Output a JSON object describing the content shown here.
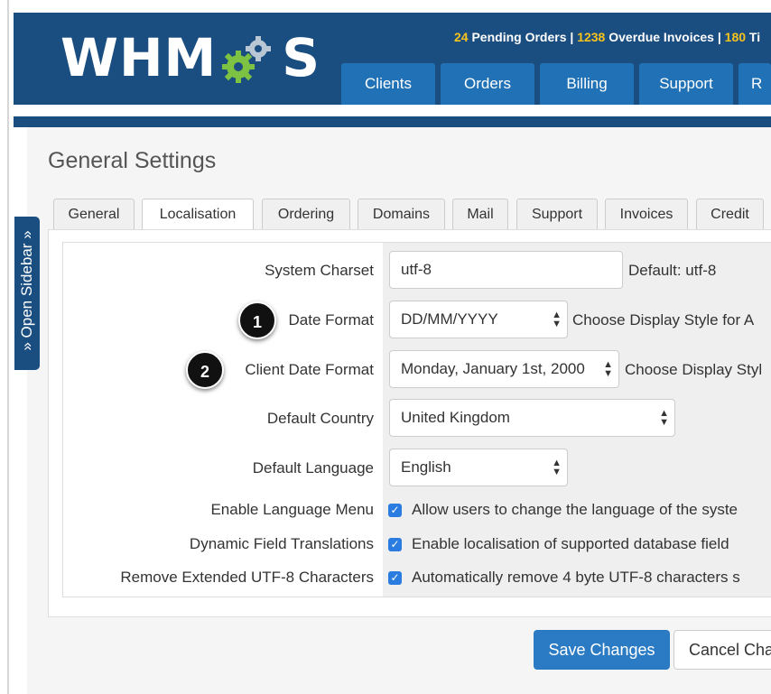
{
  "header": {
    "logo_left": "WHM",
    "logo_right": "S",
    "stats": [
      {
        "num": "24",
        "text": " Pending Orders | "
      },
      {
        "num": "1238",
        "text": " Overdue Invoices | "
      },
      {
        "num": "180",
        "text": " Ti"
      }
    ],
    "nav": [
      "Clients",
      "Orders",
      "Billing",
      "Support",
      "R"
    ]
  },
  "sidebar": {
    "toggle_label": "» Open Sidebar »"
  },
  "page": {
    "title": "General Settings"
  },
  "tabs": [
    {
      "label": "General",
      "active": false
    },
    {
      "label": "Localisation",
      "active": true
    },
    {
      "label": "Ordering",
      "active": false
    },
    {
      "label": "Domains",
      "active": false
    },
    {
      "label": "Mail",
      "active": false
    },
    {
      "label": "Support",
      "active": false
    },
    {
      "label": "Invoices",
      "active": false
    },
    {
      "label": "Credit",
      "active": false
    }
  ],
  "form": {
    "system_charset": {
      "label": "System Charset",
      "value": "utf-8",
      "hint": "Default: utf-8"
    },
    "date_format": {
      "label": "Date Format",
      "value": "DD/MM/YYYY",
      "hint": "Choose Display Style for A"
    },
    "client_date_format": {
      "label": "Client Date Format",
      "value": "Monday, January 1st, 2000",
      "hint": "Choose Display Styl"
    },
    "default_country": {
      "label": "Default Country",
      "value": "United Kingdom"
    },
    "default_language": {
      "label": "Default Language",
      "value": "English"
    },
    "enable_language_menu": {
      "label": "Enable Language Menu",
      "checked": true,
      "text": "Allow users to change the language of the syste"
    },
    "dynamic_field_translations": {
      "label": "Dynamic Field Translations",
      "checked": true,
      "text": "Enable localisation of supported database field"
    },
    "remove_extended_utf8": {
      "label": "Remove Extended UTF-8 Characters",
      "checked": true,
      "text": "Automatically remove 4 byte UTF-8 characters s"
    }
  },
  "markers": {
    "one": "1",
    "two": "2"
  },
  "buttons": {
    "save": "Save Changes",
    "cancel": "Cancel Cha"
  },
  "colors": {
    "header": "#1a4d80",
    "nav_tab": "#2071b5",
    "accent_yellow": "#f7c31d",
    "gear_green": "#7dc242",
    "save_button": "#2a7bc4"
  }
}
